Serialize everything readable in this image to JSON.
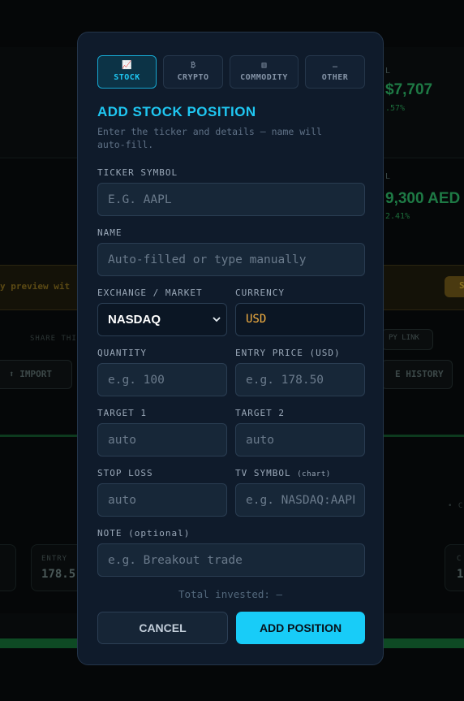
{
  "background": {
    "stat1": {
      "label": "L",
      "value": "$7,707",
      "pct": ".57%"
    },
    "stat2": {
      "label": "L",
      "value": "9,300 AED",
      "pct": "2.41%"
    },
    "warning_text": "y preview wit",
    "warning_button": "S",
    "share_text": "SHARE THIS",
    "copy_link": "PY LINK",
    "import_label": "⬆ IMPORT",
    "history_label": "E HISTORY",
    "entry_label": "ENTRY",
    "entry_value": "178.5",
    "side_label": "• C",
    "right_card_label": "C",
    "right_card_value": "1"
  },
  "tabs": [
    {
      "icon": "📈",
      "icon_name": "chart-up-icon",
      "label": "STOCK",
      "active": true
    },
    {
      "icon": "₿",
      "icon_name": "bitcoin-icon",
      "label": "CRYPTO",
      "active": false
    },
    {
      "icon": "▥",
      "icon_name": "bars-icon",
      "label": "COMMODITY",
      "active": false
    },
    {
      "icon": "…",
      "icon_name": "more-icon",
      "label": "OTHER",
      "active": false
    }
  ],
  "form": {
    "title": "ADD STOCK POSITION",
    "subtitle": "Enter the ticker and details — name will auto-fill.",
    "ticker": {
      "label": "TICKER SYMBOL",
      "placeholder": "E.G. AAPL"
    },
    "name": {
      "label": "NAME",
      "placeholder": "Auto-filled or type manually"
    },
    "exchange": {
      "label": "EXCHANGE / MARKET",
      "value": "NASDAQ"
    },
    "currency": {
      "label": "CURRENCY",
      "value": "USD"
    },
    "quantity": {
      "label": "QUANTITY",
      "placeholder": "e.g. 100"
    },
    "entry_price": {
      "label": "ENTRY PRICE (USD)",
      "placeholder": "e.g. 178.50"
    },
    "target1": {
      "label": "TARGET 1",
      "placeholder": "auto"
    },
    "target2": {
      "label": "TARGET 2",
      "placeholder": "auto"
    },
    "stop_loss": {
      "label": "STOP LOSS",
      "placeholder": "auto"
    },
    "tv_symbol": {
      "label": "TV SYMBOL",
      "label_hint": "(chart)",
      "placeholder": "e.g. NASDAQ:AAPL"
    },
    "note": {
      "label": "NOTE (optional)",
      "placeholder": "e.g. Breakout trade"
    },
    "total_invested": "Total invested: —",
    "cancel_label": "CANCEL",
    "add_label": "ADD POSITION"
  },
  "colors": {
    "accent": "#1fc7f2",
    "modal_bg": "#0f1b2b",
    "currency": "#f5b041",
    "positive": "#1e7a45"
  }
}
